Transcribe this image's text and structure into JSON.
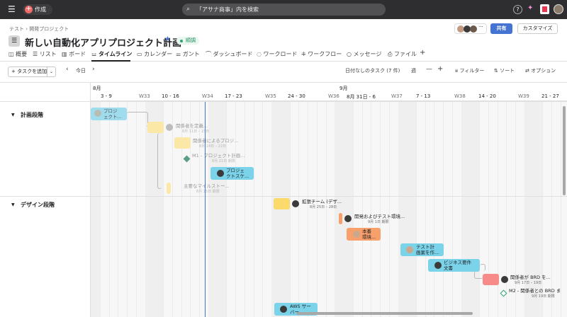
{
  "topbar": {
    "create_label": "作成",
    "search_placeholder": "「アサナ商事」内を検索"
  },
  "breadcrumb": [
    "テスト",
    "開発プロジェクト"
  ],
  "project": {
    "title": "新しい自動化アプリプロジェクト計画",
    "status": "順調",
    "share_label": "共有",
    "customize_label": "カスタマイズ"
  },
  "tabs": [
    {
      "label": "概要",
      "icon": "overview-icon"
    },
    {
      "label": "リスト",
      "icon": "list-icon"
    },
    {
      "label": "ボード",
      "icon": "board-icon"
    },
    {
      "label": "タイムライン",
      "icon": "timeline-icon",
      "active": true
    },
    {
      "label": "カレンダー",
      "icon": "calendar-icon"
    },
    {
      "label": "ガント",
      "icon": "gantt-icon"
    },
    {
      "label": "ダッシュボード",
      "icon": "dashboard-icon"
    },
    {
      "label": "ワークロード",
      "icon": "workload-icon"
    },
    {
      "label": "ワークフロー",
      "icon": "workflow-icon"
    },
    {
      "label": "メッセージ",
      "icon": "message-icon"
    },
    {
      "label": "ファイル",
      "icon": "file-icon"
    }
  ],
  "toolbar": {
    "add_task": "+ タスクを追加",
    "today": "今日",
    "unscheduled": "日付なしのタスク (7 件)",
    "zoom": "週",
    "filter": "フィルター",
    "sort": "ソート",
    "options": "オプション"
  },
  "timeline": {
    "months": [
      "8月",
      "9月"
    ],
    "weeks": [
      "3 - 9",
      "W33",
      "10 - 16",
      "W34",
      "17 - 23",
      "W35",
      "24 - 30",
      "W36",
      "8月 31日 - 6",
      "W37",
      "7 - 13",
      "W38",
      "14 - 20",
      "W39",
      "21 - 27"
    ],
    "sections": [
      "計画段階",
      "デザイン段階"
    ],
    "tasks": [
      {
        "label": "プロジ\nェクト...",
        "color": "#7bd3ea"
      },
      {
        "label": "関係者を定義...",
        "sub": "8月 11日 – 15日",
        "color": "#fcd96b"
      },
      {
        "label": "関係者によるプロジ...",
        "sub": "8月 14日 – 22日",
        "color": "#fcd96b"
      },
      {
        "label": "M1 - プロジェクト計画...",
        "sub": "8月 21日 期限",
        "milestone": true
      },
      {
        "label": "プロジェ\nクトスケ...",
        "color": "#7bd3ea"
      },
      {
        "label": "主要なマイルストー...",
        "sub": "8月 15日 期限",
        "color": "#fcd96b"
      },
      {
        "label": "拡張チーム (デザ...",
        "sub": "8月 25日 – 28日",
        "color": "#fcd96b"
      },
      {
        "label": "開発およびテスト環境...",
        "sub": "9月 1日 期限",
        "color": "#f8a06b"
      },
      {
        "label": "本番\n環境...",
        "color": "#f8a06b"
      },
      {
        "label": "テスト計\n画案を作...",
        "color": "#7bd3ea"
      },
      {
        "label": "ビジネス要件\n文書",
        "color": "#7bd3ea"
      },
      {
        "label": "関係者が BRD を...",
        "sub": "9月 17日 – 19日",
        "color": "#f78b89"
      },
      {
        "label": "M2 - 関係者との BRD ま",
        "sub": "9月 19日 期限",
        "milestone": true
      },
      {
        "label": "AWS サー\nバー...",
        "color": "#7bd3ea"
      }
    ]
  }
}
